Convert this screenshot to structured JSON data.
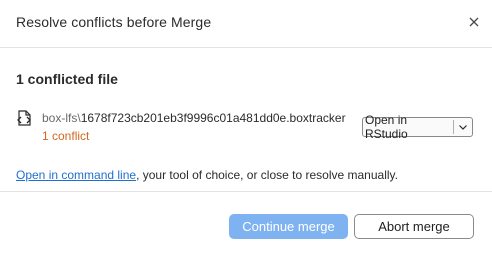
{
  "dialog": {
    "title": "Resolve conflicts before Merge",
    "close_icon": "close-icon"
  },
  "summary": {
    "count_label": "1 conflicted file"
  },
  "files": [
    {
      "icon": "file-code-icon",
      "directory": "box-lfs\\",
      "filename": "1678f723cb201eb3f9996c01a481dd0e.boxtracker",
      "conflict_label": "1 conflict",
      "open_button_label": "Open in RStudio",
      "dropdown_icon": "chevron-down-icon"
    }
  ],
  "hint": {
    "link_text": "Open in command line",
    "rest_text": ", your tool of choice, or close to resolve manually."
  },
  "actions": {
    "continue_label": "Continue merge",
    "abort_label": "Abort merge"
  },
  "colors": {
    "primary": "#7fb2f0",
    "conflict": "#d3661f",
    "link": "#1f6fd1"
  }
}
